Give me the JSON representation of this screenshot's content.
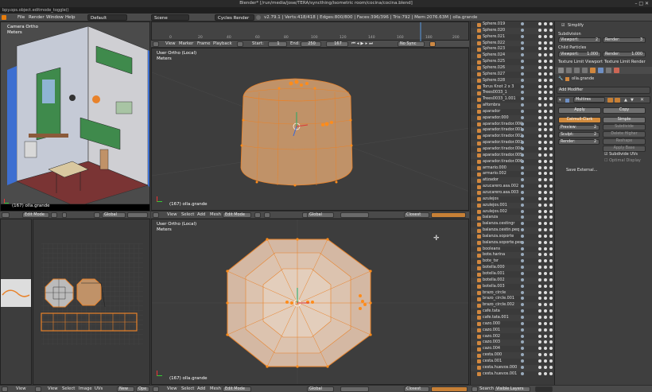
{
  "window": {
    "title": "Blender* [/run/media/jose/TERA/syncthing/isometric room/cocina/cocina.blend]",
    "controls": "– □ ✕"
  },
  "command_line": "bpy.ops.object.editmode_toggle()",
  "topbar": {
    "menus": [
      "File",
      "Render",
      "Window",
      "Help"
    ],
    "layout": "Default",
    "scene": "Scene",
    "engine": "Cycles Render",
    "stats": "v2.79.1 | Verts:418/418 | Edges:800/800 | Faces:396/396 | Tris:792 | Mem:2076.63M | olla.grande"
  },
  "viewport_camera": {
    "line1": "Camera Ortho",
    "line2": "Meters",
    "footer": "(167) olla.grande",
    "mode": "Edit Mode",
    "orientation": "Global",
    "menus": [
      "View",
      "Select",
      "Add",
      "Mesh"
    ]
  },
  "timeline": {
    "menus": [
      "View",
      "Marker",
      "Frame",
      "Playback"
    ],
    "start_label": "Start:",
    "start": "1",
    "end_label": "End:",
    "end": "250",
    "current": "167",
    "sync": "No Sync"
  },
  "viewport_top": {
    "line1": "User Ortho (Local)",
    "line2": "Meters",
    "footer": "(167) olla.grande",
    "menus": [
      "View",
      "Select",
      "Add",
      "Mesh"
    ],
    "mode": "Edit Mode",
    "orientation": "Global",
    "snap": "Closest"
  },
  "viewport_bottom": {
    "line1": "User Ortho (Local)",
    "line2": "Meters",
    "footer": "(167) olla.grande",
    "menus": [
      "View",
      "Select",
      "Add",
      "Mesh"
    ],
    "mode": "Edit Mode",
    "orientation": "Global",
    "snap": "Closest"
  },
  "uv_editor": {
    "menus": [
      "View",
      "Select",
      "Image",
      "UVs"
    ],
    "new_label": "New",
    "open_label": "Ope"
  },
  "left_lower": {
    "menus": [
      "View"
    ]
  },
  "outliner": {
    "items": [
      "Sphere.019",
      "Sphere.020",
      "Sphere.021",
      "Sphere.022",
      "Sphere.023",
      "Sphere.024",
      "Sphere.025",
      "Sphere.026",
      "Sphere.027",
      "Sphere.028",
      "Torus Knot 2 x 3",
      "Trees0033_1",
      "Trees0033_1.001",
      "alfombra",
      "aparador",
      "aparador.000",
      "aparador.tirador.000",
      "aparador.tirador.001",
      "aparador.tirador.002",
      "aparador.tirador.003",
      "aparador.tirador.004",
      "aparador.tirador.005",
      "aparador.tirador.006",
      "armario.000",
      "armario.002",
      "atizador",
      "azucarero.asa.002",
      "azucarero.asa.003",
      "azulejos",
      "azulejos.001",
      "azulejos.002",
      "balanza",
      "balanza.cestingr",
      "balanza.cestin.peq",
      "balanza.soporte",
      "balanza.soporte.peq",
      "booleans",
      "bote.harina",
      "bote_tsr",
      "botella.000",
      "botella.001",
      "botella.002",
      "botella.003",
      "brazo_circle",
      "brazo_circle.001",
      "brazo_circle.002",
      "cafe.tata",
      "cafe.tata.001",
      "cazo.000",
      "cazo.001",
      "cazo.002",
      "cazo.003",
      "cazo.004",
      "cesta.000",
      "cesta.001",
      "cesta.huevos.000",
      "cesta.huevos.001"
    ],
    "search_label": "Search",
    "layers_label": "Visible Layers",
    "filter": "All"
  },
  "properties": {
    "simplify": "Simplify",
    "subdivision": "Subdivision",
    "viewport_label": "Viewport:",
    "viewport_val": "2",
    "render_label": "Render:",
    "render_val": "3",
    "child_particles": "Child Particles",
    "cp_viewport_label": "Viewport:",
    "cp_viewport_val": "1.000",
    "cp_render_label": "Render:",
    "cp_render_val": "1.000",
    "tex_limit_vp": "Texture Limit Viewport",
    "tex_limit_rn": "Texture Limit Render",
    "object_name": "olla.grande",
    "add_modifier": "Add Modifier",
    "modifier_name": "Multires",
    "apply": "Apply",
    "copy": "Copy",
    "catmull": "Catmull-Clark",
    "simple": "Simple",
    "preview_label": "Preview:",
    "preview_val": "2",
    "sculpt_label": "Sculpt:",
    "sculpt_val": "2",
    "render2_label": "Render:",
    "render2_val": "2",
    "subdivide": "Subdivide",
    "delete_higher": "Delete Higher",
    "reshape": "Reshape",
    "apply_base": "Apply Base",
    "subdivide_uvs": "Subdivide UVs",
    "optimal_display": "Optimal Display",
    "save_external": "Save External..."
  },
  "colors": {
    "selected": "#e8822a",
    "mesh": "#c09268",
    "bg": "#3d3d3d"
  }
}
